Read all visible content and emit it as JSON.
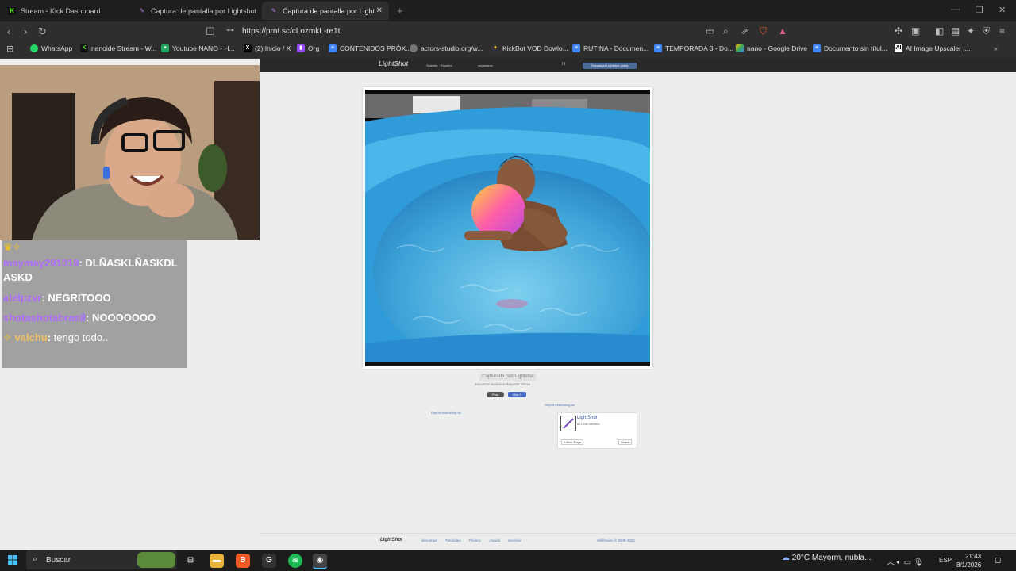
{
  "browser": {
    "tabs": [
      {
        "title": "Stream - Kick Dashboard",
        "active": false
      },
      {
        "title": "Captura de pantalla por Lightshot",
        "active": false
      },
      {
        "title": "Captura de pantalla por Lightshot",
        "active": true
      }
    ],
    "new_tab": "+",
    "url": "https://prnt.sc/cLozmkL-re1t",
    "bookmarks": [
      {
        "label": "WhatsApp",
        "icon": "whatsapp-icon",
        "color": "#25d366"
      },
      {
        "label": "nanoide Stream - W...",
        "icon": "kick-icon",
        "color": "#53fc18"
      },
      {
        "label": "Youtube NANO - H...",
        "icon": "sheets-icon",
        "color": "#1fa463"
      },
      {
        "label": "(2) Inicio / X",
        "icon": "x-icon",
        "color": "#000000"
      },
      {
        "label": "Org",
        "icon": "twitch-icon",
        "color": "#9146ff"
      },
      {
        "label": "CONTENIDOS PRÓX...",
        "icon": "docs-icon",
        "color": "#4285f4"
      },
      {
        "label": "actors-studio.org/w...",
        "icon": "globe-icon",
        "color": "#888888"
      },
      {
        "label": "KickBot VOD Dowlo...",
        "icon": "kickbot-icon",
        "color": "#f5c518"
      },
      {
        "label": "RUTINA - Documen...",
        "icon": "docs-icon",
        "color": "#4285f4"
      },
      {
        "label": "TEMPORADA 3 - Do...",
        "icon": "docs-icon",
        "color": "#4285f4"
      },
      {
        "label": "nano - Google Drive",
        "icon": "drive-icon",
        "color": "#fbbc04"
      },
      {
        "label": "Documento sin títul...",
        "icon": "docs-icon",
        "color": "#4285f4"
      },
      {
        "label": "AI Image Upscaler |...",
        "icon": "ai-icon",
        "color": "#ffffff"
      }
    ]
  },
  "lightshot": {
    "logo": "LightShot",
    "language": "Spanish · Español",
    "register": "registrarse",
    "download_button": "Descargar Lightshot gratis",
    "social": "f  t",
    "captured_label": "Capturado con Lightshot",
    "small_links": "encontrar similares   Reportar abuso",
    "post_button": "Post",
    "like_button": "Like 0",
    "report_link": "Report misleading ad",
    "fb_page": {
      "name": "LightShot",
      "subtitle": "88.1,948 followers",
      "follow": "Follow Page",
      "share": "Share"
    },
    "footer_logo": "LightShot",
    "footer_links": [
      "descargar",
      "Tutoriales",
      "Privacy",
      "¡Ayuda",
      "anunciar"
    ],
    "footer_copy": "Skillbrains © 2009-2022"
  },
  "chat": {
    "messages": [
      {
        "user": "maymay291018",
        "text": "DLÑASKLÑASKDL ASKD"
      },
      {
        "user": "alelpzvr",
        "text": "NEGRITOOO"
      },
      {
        "user": "shotashotabrasil",
        "text": "NOOOOOOO"
      },
      {
        "user": "valchu",
        "text": "tengo todo.."
      }
    ]
  },
  "taskbar": {
    "search_placeholder": "Buscar",
    "weather_temp": "20°C",
    "weather_desc": "Mayorm. nubla...",
    "lang": "ESP",
    "time": "21:43",
    "date": "8/1/2026",
    "weather_badge": "1"
  },
  "colors": {
    "chat_user": "#b06cff",
    "accent": "#4a6a9a"
  }
}
